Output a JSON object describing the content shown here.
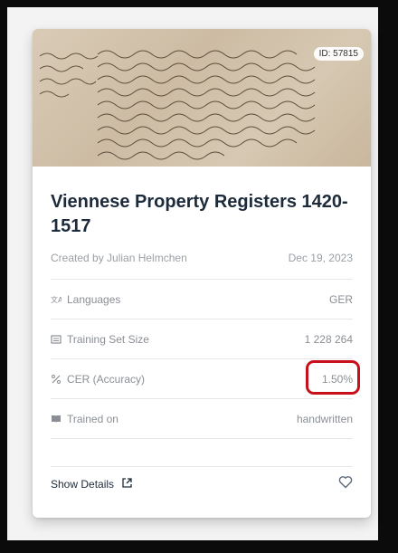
{
  "card": {
    "id_badge": "ID: 57815",
    "title": "Viennese Property Registers 1420-1517",
    "created_by": "Created by Julian Helmchen",
    "date": "Dec 19, 2023",
    "rows": [
      {
        "icon": "translate-icon",
        "label": "Languages",
        "value": "GER"
      },
      {
        "icon": "training-set-icon",
        "label": "Training Set Size",
        "value": "1 228 264"
      },
      {
        "icon": "percent-icon",
        "label": "CER (Accuracy)",
        "value": "1.50%"
      },
      {
        "icon": "book-icon",
        "label": "Trained on",
        "value": "handwritten"
      }
    ],
    "show_details": "Show Details",
    "heart_icon": "heart-icon",
    "external_link_icon": "external-link-icon",
    "highlight_color": "#c8101a"
  }
}
